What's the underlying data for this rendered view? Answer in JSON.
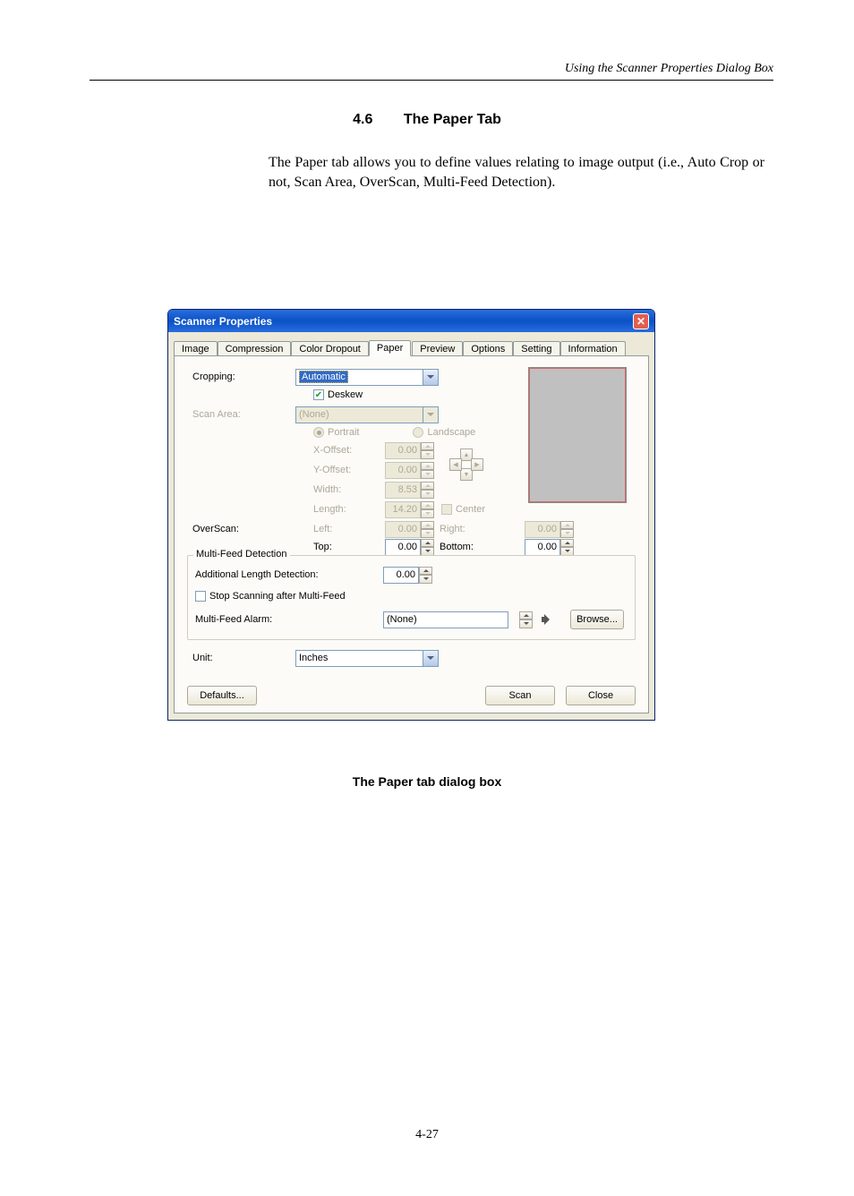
{
  "header": {
    "left": "",
    "right": "Using the Scanner Properties Dialog Box"
  },
  "section": {
    "num": "4.6",
    "title": "The Paper Tab"
  },
  "section_body": "The Paper tab allows you to define values relating to image output (i.e., Auto Crop or not, Scan Area, OverScan, Multi-Feed Detection).",
  "dialog": {
    "title": "Scanner Properties",
    "tabs": [
      "Image",
      "Compression",
      "Color Dropout",
      "Paper",
      "Preview",
      "Options",
      "Setting",
      "Information"
    ],
    "active_tab": 3,
    "cropping_label": "Cropping:",
    "cropping_value": "Automatic",
    "deskew_label": "Deskew",
    "scan_area_label": "Scan Area:",
    "scan_area_value": "(None)",
    "portrait_label": "Portrait",
    "landscape_label": "Landscape",
    "xoffset_label": "X-Offset:",
    "xoffset_val": "0.00",
    "yoffset_label": "Y-Offset:",
    "yoffset_val": "0.00",
    "width_label": "Width:",
    "width_val": "8.53",
    "length_label": "Length:",
    "length_val": "14.20",
    "center_label": "Center",
    "overscan_label": "OverScan:",
    "left_label": "Left:",
    "left_val": "0.00",
    "right_label": "Right:",
    "right_val": "0.00",
    "top_label": "Top:",
    "top_val": "0.00",
    "bottom_label": "Bottom:",
    "bottom_val": "0.00",
    "group_title": "Multi-Feed Detection",
    "addlen_label": "Additional Length Detection:",
    "addlen_val": "0.00",
    "stopscan_label": "Stop Scanning after Multi-Feed",
    "alarm_label": "Multi-Feed Alarm:",
    "alarm_value": "(None)",
    "browse_label": "Browse...",
    "unit_label": "Unit:",
    "unit_value": "Inches",
    "defaults_label": "Defaults...",
    "scan_label": "Scan",
    "close_label": "Close"
  },
  "caption": "The Paper tab dialog box",
  "page_number": "4-27"
}
